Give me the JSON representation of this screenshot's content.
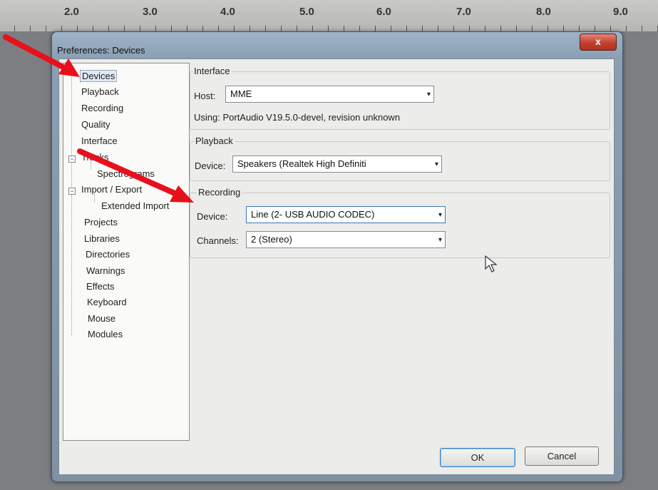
{
  "ruler": {
    "marks": [
      "2.0",
      "3.0",
      "4.0",
      "5.0",
      "6.0",
      "7.0",
      "8.0",
      "9.0"
    ]
  },
  "window": {
    "title": "Preferences: Devices",
    "close_label": "x"
  },
  "tree": {
    "items": [
      {
        "label": "Devices"
      },
      {
        "label": "Playback"
      },
      {
        "label": "Recording"
      },
      {
        "label": "Quality"
      },
      {
        "label": "Interface"
      },
      {
        "label": "Tracks"
      },
      {
        "label": "Spectrograms"
      },
      {
        "label": "Import / Export"
      },
      {
        "label": "Extended Import"
      },
      {
        "label": "Projects"
      },
      {
        "label": "Libraries"
      },
      {
        "label": "Directories"
      },
      {
        "label": "Warnings"
      },
      {
        "label": "Effects"
      },
      {
        "label": "Keyboard"
      },
      {
        "label": "Mouse"
      },
      {
        "label": "Modules"
      }
    ],
    "expander_minus": "−"
  },
  "interface": {
    "group_label": "Interface",
    "host_label": "Host:",
    "host_value": "MME",
    "using_text": "Using: PortAudio V19.5.0-devel, revision unknown"
  },
  "playback": {
    "group_label": "Playback",
    "device_label": "Device:",
    "device_value": "Speakers (Realtek High Definiti"
  },
  "recording": {
    "group_label": "Recording",
    "device_label": "Device:",
    "device_value": "Line (2- USB AUDIO  CODEC)",
    "channels_label": "Channels:",
    "channels_value": "2 (Stereo)"
  },
  "buttons": {
    "ok": "OK",
    "cancel": "Cancel"
  },
  "icons": {
    "dropdown": "▾",
    "cursor": "mouse-pointer"
  },
  "colors": {
    "annotation_arrow": "#e8101a",
    "focus_border": "#3c78b4"
  }
}
